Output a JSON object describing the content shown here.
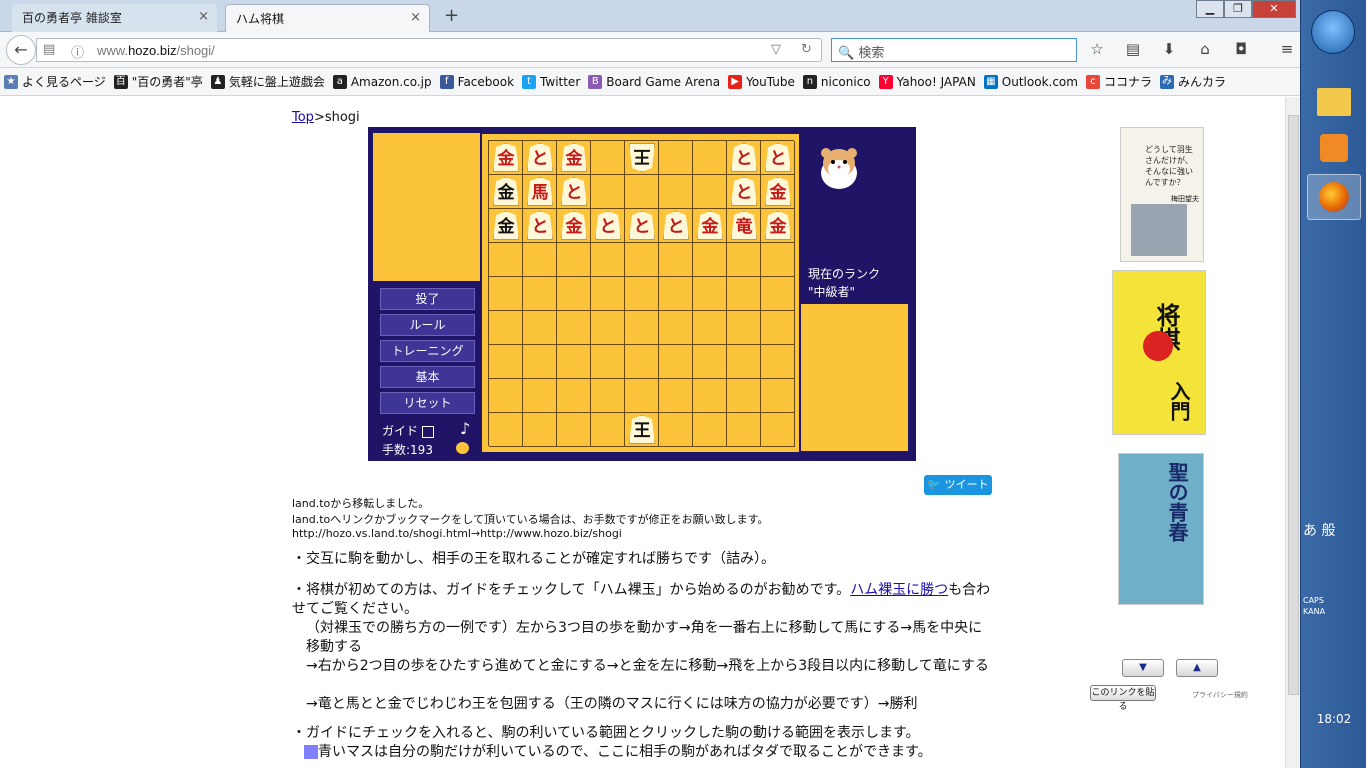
{
  "tabs": [
    {
      "label": "百の勇者亭 雑談室",
      "close": "×"
    },
    {
      "label": "ハム将棋",
      "close": "×"
    }
  ],
  "new_tab": "+",
  "window_buttons": {
    "minimize": "▁",
    "restore": "❐",
    "close": "✕"
  },
  "url": {
    "prefix": "www.",
    "domain": "hozo.biz",
    "path": "/shogi/"
  },
  "search_placeholder": "検索",
  "bookmarks": [
    {
      "label": "よく見るページ",
      "color": "#5b7fb3",
      "glyph": "★"
    },
    {
      "label": "\"百の勇者\"亭",
      "color": "#222",
      "glyph": "百"
    },
    {
      "label": "気軽に盤上遊戯会",
      "color": "#222",
      "glyph": "♟"
    },
    {
      "label": "Amazon.co.jp",
      "color": "#222",
      "glyph": "a"
    },
    {
      "label": "Facebook",
      "color": "#3b5998",
      "glyph": "f"
    },
    {
      "label": "Twitter",
      "color": "#1da1f2",
      "glyph": "t"
    },
    {
      "label": "Board Game Arena",
      "color": "#8a5bb3",
      "glyph": "B"
    },
    {
      "label": "YouTube",
      "color": "#e62117",
      "glyph": "▶"
    },
    {
      "label": "niconico",
      "color": "#222",
      "glyph": "n"
    },
    {
      "label": "Yahoo! JAPAN",
      "color": "#ff0033",
      "glyph": "Y"
    },
    {
      "label": "Outlook.com",
      "color": "#0072c6",
      "glyph": "▦"
    },
    {
      "label": "ココナラ",
      "color": "#e8463a",
      "glyph": "c"
    },
    {
      "label": "みんカラ",
      "color": "#2a6ab3",
      "glyph": "み"
    }
  ],
  "breadcrumb": {
    "link": "Top",
    "sep": ">",
    "current": "shogi"
  },
  "game": {
    "menu": [
      "投了",
      "ルール",
      "トレーニング",
      "基本",
      "リセット"
    ],
    "guide_label": "ガイド",
    "music_note": "♪",
    "moves_label": "手数:193",
    "rank_label": "現在のランク",
    "rank_value": "\"中級者\"",
    "board": [
      [
        "金r",
        "とr",
        "金rp",
        "",
        "王bf",
        "",
        "",
        "とr",
        "とr"
      ],
      [
        "金b",
        "馬r",
        "とr",
        "",
        "",
        "",
        "",
        "とr",
        "金rp"
      ],
      [
        "金b",
        "とr",
        "金rp",
        "とr",
        "とr",
        "とr",
        "金rp",
        "竜r",
        "金rp"
      ],
      [
        "",
        "",
        "",
        "",
        "",
        "",
        "",
        "",
        ""
      ],
      [
        "",
        "",
        "",
        "",
        "",
        "",
        "",
        "",
        ""
      ],
      [
        "",
        "",
        "",
        "",
        "",
        "",
        "",
        "",
        ""
      ],
      [
        "",
        "",
        "",
        "",
        "",
        "",
        "",
        "",
        ""
      ],
      [
        "",
        "",
        "",
        "",
        "",
        "",
        "",
        "",
        ""
      ],
      [
        "",
        "",
        "",
        "",
        "王b",
        "",
        "",
        "",
        ""
      ]
    ]
  },
  "tweet_label": "ツイート",
  "notice": [
    "land.toから移転しました。",
    "land.toへリンクかブックマークをして頂いている場合は、お手数ですが修正をお願い致します。",
    "http://hozo.vs.land.to/shogi.html→http://www.hozo.biz/shogi"
  ],
  "paragraphs": {
    "p1": "・交互に駒を動かし、相手の王を取れることが確定すれば勝ちです（詰み）。",
    "p2a": "・将棋が初めての方は、ガイドをチェックして「ハム裸玉」から始めるのがお勧めです。",
    "p2link": "ハム裸玉に勝つ",
    "p2b": "も合わせてご覧ください。",
    "p3": "（対裸玉での勝ち方の一例です）左から3つ目の歩を動かす→角を一番右上に移動して馬にする→馬を中央に移動する",
    "p4": "→右から2つ目の歩をひたすら進めてと金にする→と金を左に移動→飛を上から3段目以内に移動して竜にする",
    "p5": "→竜と馬とと金でじわじわ王を包囲する（王の隣のマスに行くには味方の協力が必要です）→勝利",
    "p6": "・ガイドにチェックを入れると、駒の利いている範囲とクリックした駒の動ける範囲を表示します。",
    "p7": "青いマスは自分の駒だけが利いているので、ここに相手の駒があればタダで取ることができます。"
  },
  "colors": {
    "blue_square": "#8080ff",
    "board": "#fcc43a",
    "panel": "#1f1466"
  },
  "ads": {
    "up": "▼",
    "down": "▲",
    "link_button": "このリンクを貼る",
    "privacy": "プライバシー規約",
    "book1_text": "どうして羽生さんだけが、そんなに強いんですか？",
    "book1_author": "梅田望夫",
    "book2_title": "将棋",
    "book2_sub": "入門",
    "book3_title": "聖の青春"
  },
  "taskbar": {
    "ime": "あ 般",
    "caps": "CAPS",
    "kana": "KANA",
    "clock": "18:02"
  }
}
